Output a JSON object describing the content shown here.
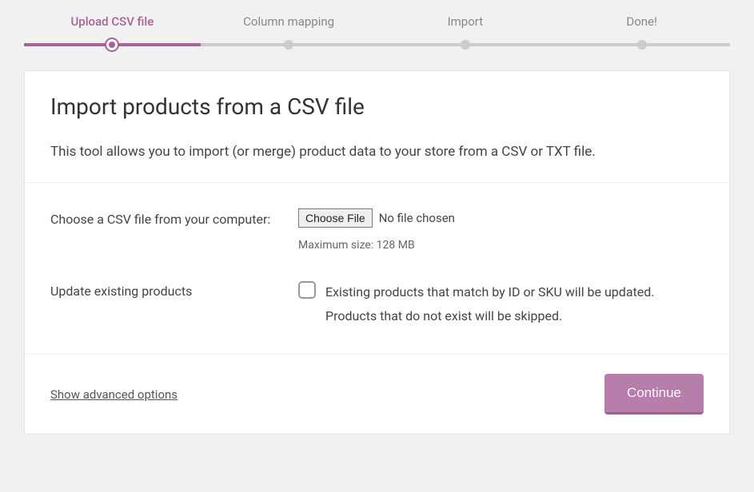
{
  "steps": {
    "s0": "Upload CSV file",
    "s1": "Column mapping",
    "s2": "Import",
    "s3": "Done!"
  },
  "panel": {
    "title": "Import products from a CSV file",
    "description": "This tool allows you to import (or merge) product data to your store from a CSV or TXT file."
  },
  "form": {
    "file_label": "Choose a CSV file from your computer:",
    "choose_button": "Choose File",
    "no_file_text": "No file chosen",
    "max_size_text": "Maximum size: 128 MB",
    "update_label": "Update existing products",
    "update_description": "Existing products that match by ID or SKU will be updated. Products that do not exist will be skipped."
  },
  "footer": {
    "advanced_link": "Show advanced options",
    "continue_button": "Continue"
  }
}
